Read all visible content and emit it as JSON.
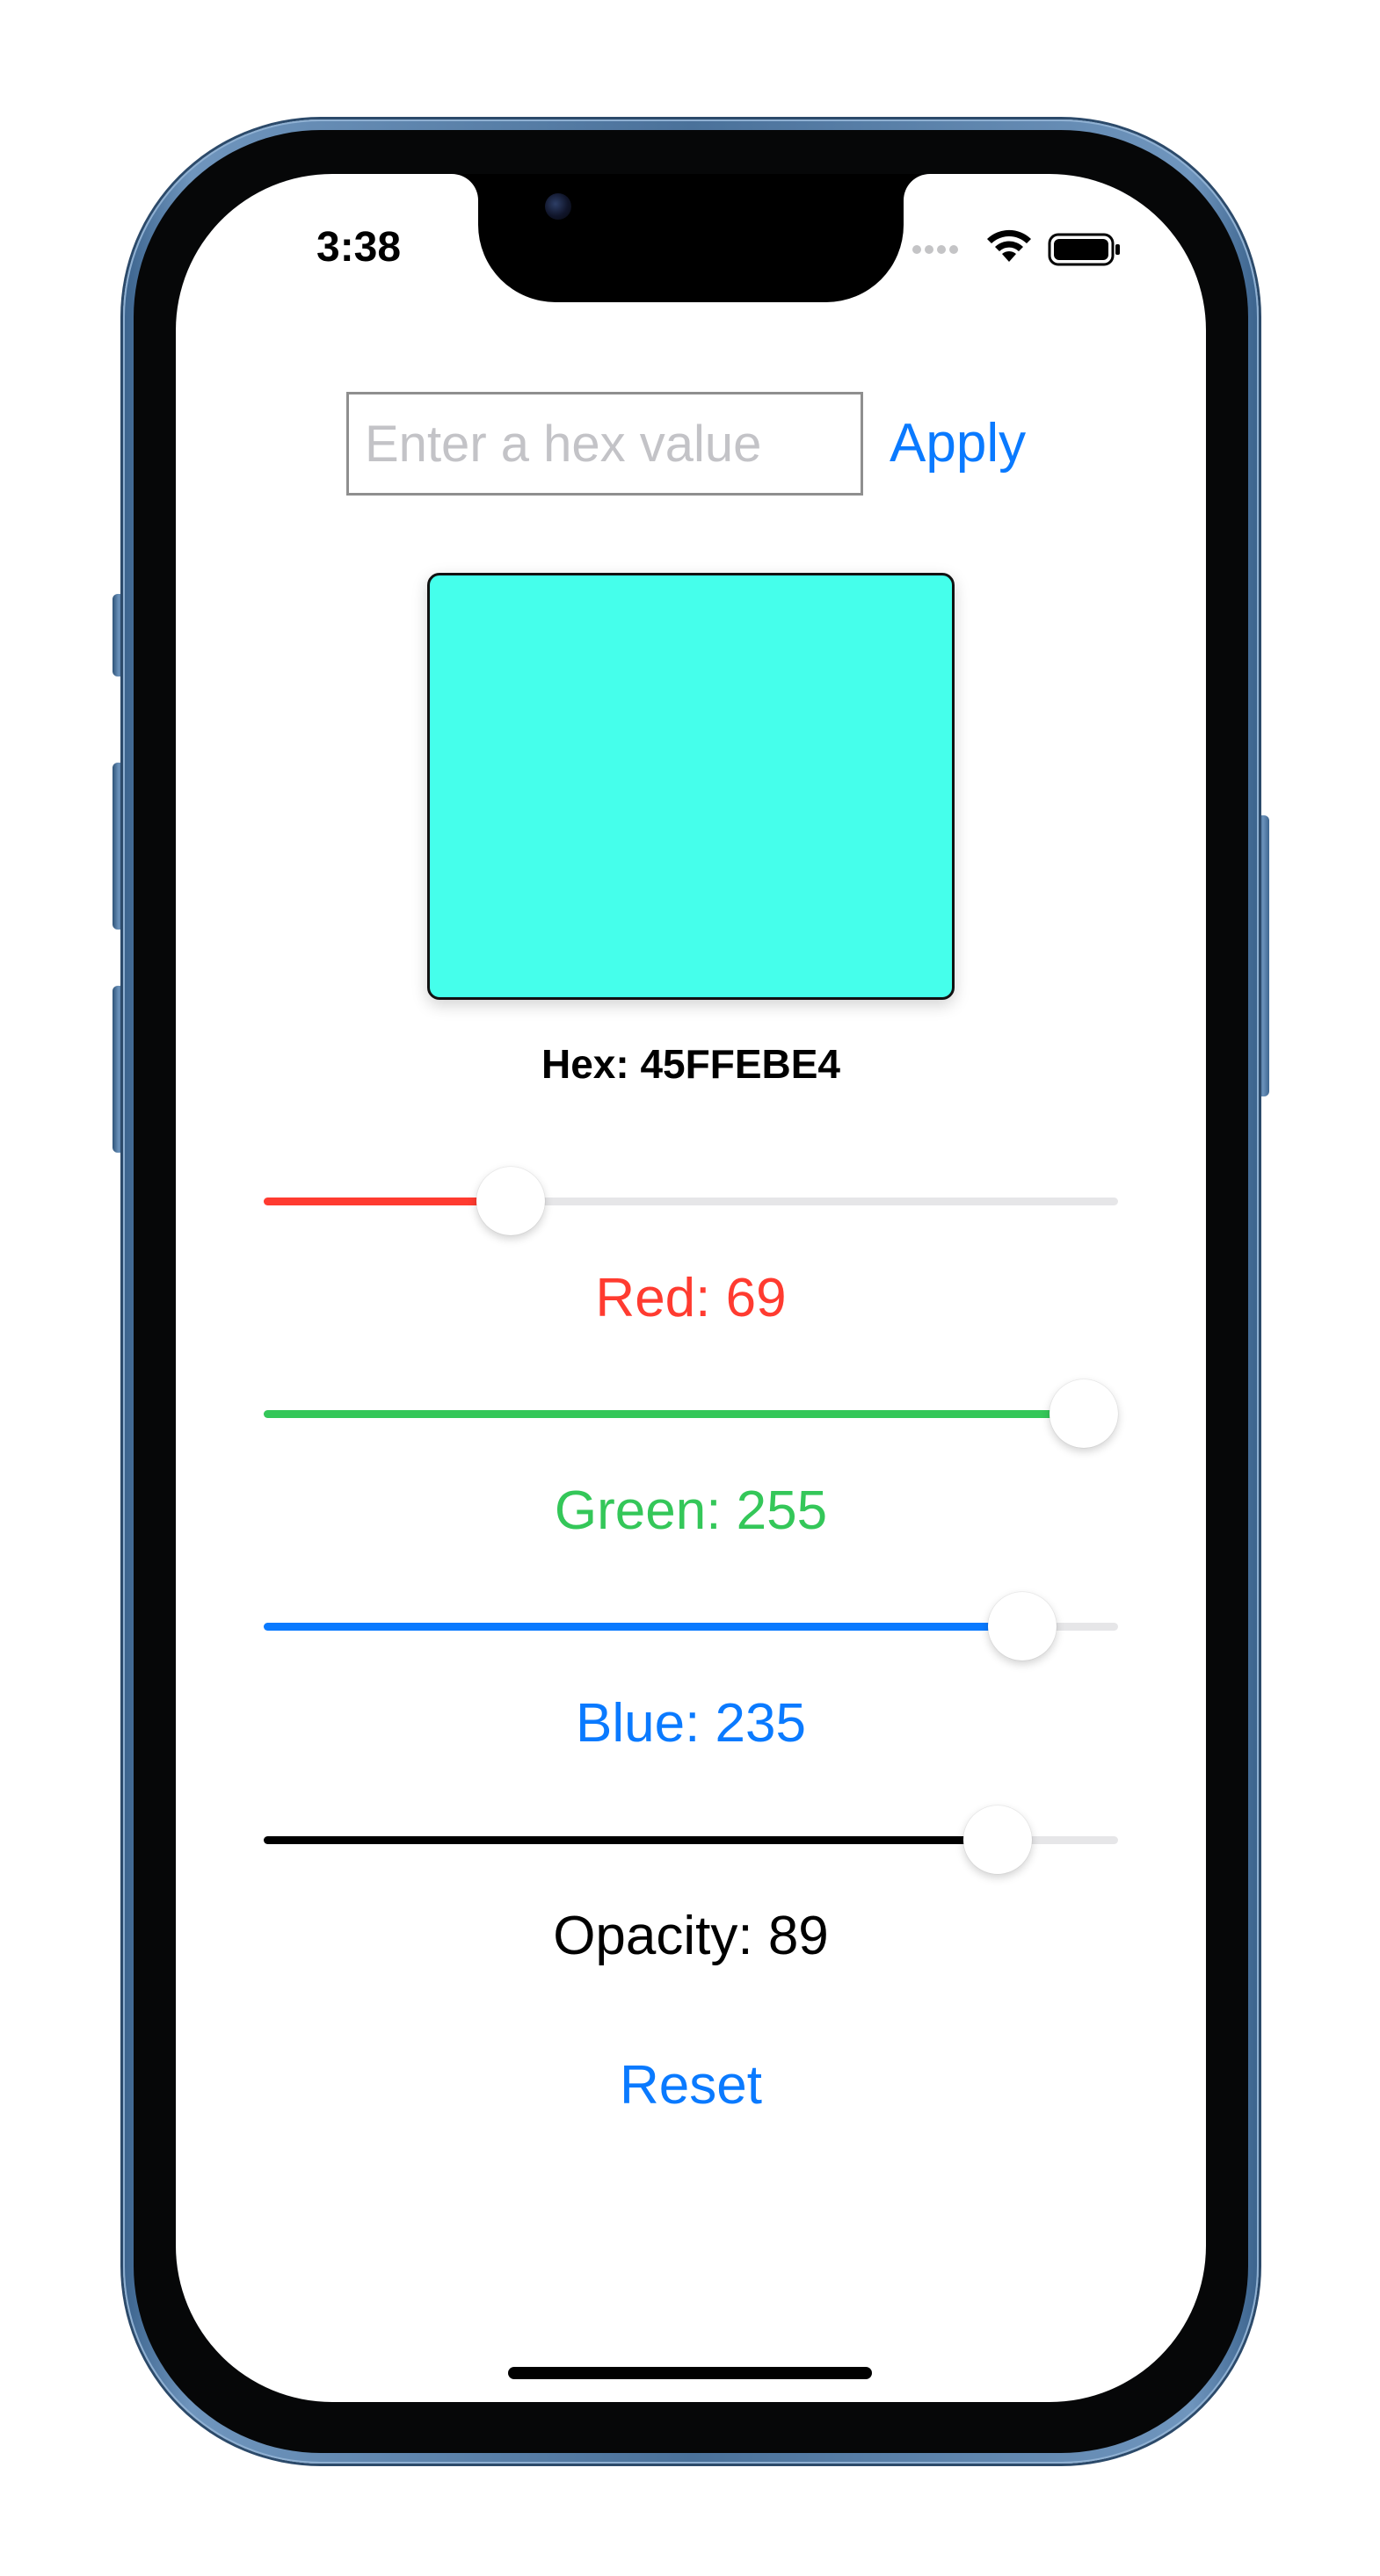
{
  "status_bar": {
    "time": "3:38"
  },
  "hex_entry": {
    "placeholder": "Enter a hex value",
    "value": "",
    "apply_label": "Apply"
  },
  "preview": {
    "color": "#45FFEB",
    "opacity_fraction": 0.89
  },
  "hex_display": {
    "text": "Hex: 45FFEBE4"
  },
  "sliders": {
    "red": {
      "label": "Red: 69",
      "value": 69,
      "max": 255,
      "color": "#ff3b30"
    },
    "green": {
      "label": "Green: 255",
      "value": 255,
      "max": 255,
      "color": "#34c759"
    },
    "blue": {
      "label": "Blue: 235",
      "value": 235,
      "max": 255,
      "color": "#0a7aff"
    },
    "opacity": {
      "label": "Opacity: 89",
      "value": 89,
      "max": 100,
      "color": "#000000"
    }
  },
  "actions": {
    "reset_label": "Reset"
  },
  "theme": {
    "accent": "#0a7aff",
    "device_color": "#4a719a"
  }
}
